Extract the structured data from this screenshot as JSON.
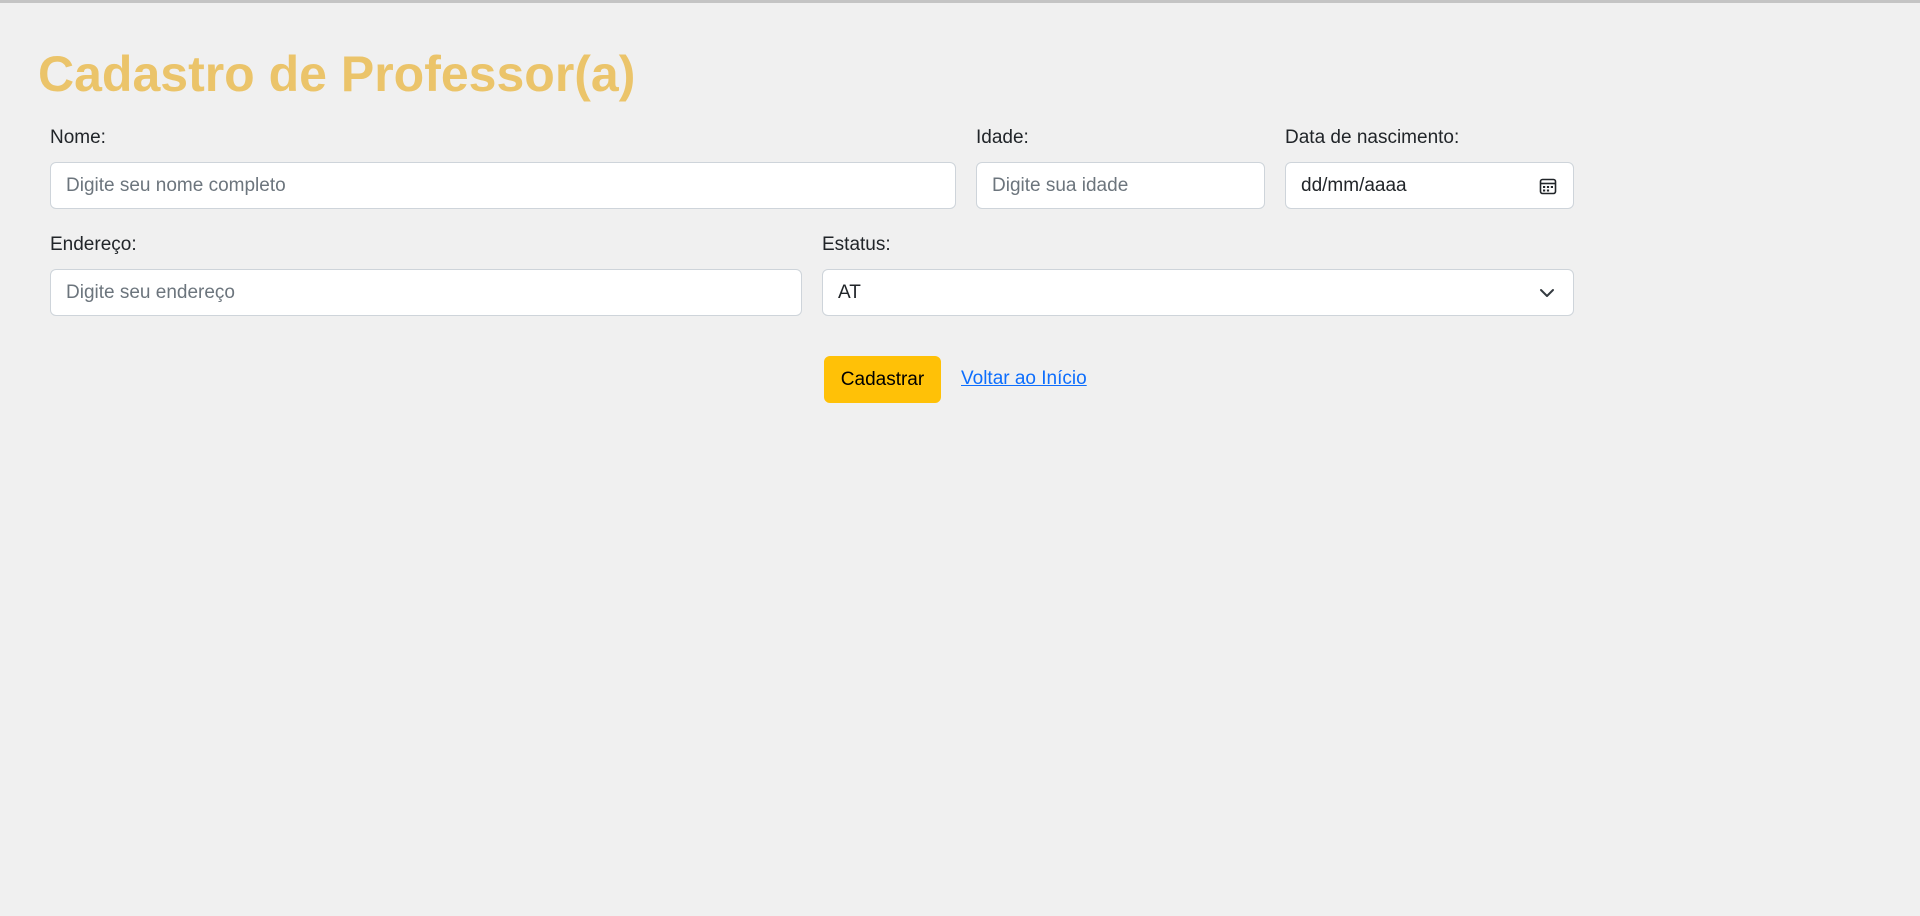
{
  "page": {
    "title": "Cadastro de Professor(a)"
  },
  "form": {
    "nome": {
      "label": "Nome:",
      "placeholder": "Digite seu nome completo",
      "value": ""
    },
    "idade": {
      "label": "Idade:",
      "placeholder": "Digite sua idade",
      "value": ""
    },
    "data_nascimento": {
      "label": "Data de nascimento:",
      "value": "dd/mm/aaaa",
      "icon": "calendar-icon"
    },
    "endereco": {
      "label": "Endereço:",
      "placeholder": "Digite seu endereço",
      "value": ""
    },
    "estatus": {
      "label": "Estatus:",
      "selected": "AT",
      "icon": "chevron-down-icon"
    }
  },
  "actions": {
    "submit_label": "Cadastrar",
    "back_link_label": "Voltar ao Início"
  },
  "colors": {
    "background": "#f0f0f0",
    "title": "#ebc46a",
    "submit": "#ffc107",
    "link": "#0d6efd"
  }
}
